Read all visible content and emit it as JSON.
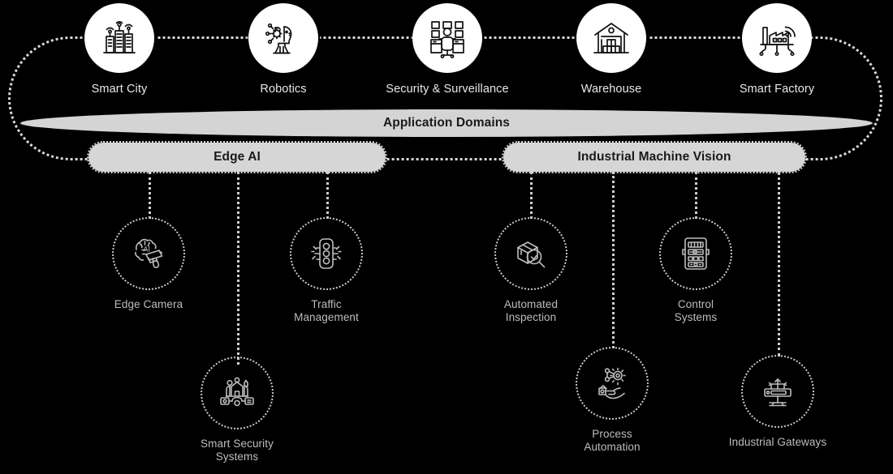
{
  "diagram": {
    "center_bar": {
      "label": "Application Domains"
    },
    "categories": [
      {
        "id": "edge-ai",
        "label": "Edge AI"
      },
      {
        "id": "industrial-machine-vision",
        "label": "Industrial Machine Vision"
      }
    ],
    "domains": [
      {
        "label": "Smart City",
        "icon": "smart-city-icon"
      },
      {
        "label": "Robotics",
        "icon": "robotics-icon"
      },
      {
        "label": "Security & Surveillance",
        "icon": "security-surveillance-icon"
      },
      {
        "label": "Warehouse",
        "icon": "warehouse-icon"
      },
      {
        "label": "Smart Factory",
        "icon": "smart-factory-icon"
      }
    ],
    "edge_ai_nodes": [
      {
        "label_line1": "Edge Camera",
        "label_line2": "",
        "icon": "edge-camera-icon"
      },
      {
        "label_line1": "Smart Security",
        "label_line2": "Systems",
        "icon": "smart-security-systems-icon"
      },
      {
        "label_line1": "Traffic",
        "label_line2": "Management",
        "icon": "traffic-management-icon"
      }
    ],
    "imv_nodes": [
      {
        "label_line1": "Automated",
        "label_line2": "Inspection",
        "icon": "automated-inspection-icon"
      },
      {
        "label_line1": "Process",
        "label_line2": "Automation",
        "icon": "process-automation-icon"
      },
      {
        "label_line1": "Control",
        "label_line2": "Systems",
        "icon": "control-systems-icon"
      },
      {
        "label_line1": "Industrial Gateways",
        "label_line2": "",
        "icon": "industrial-gateways-icon"
      }
    ],
    "colors": {
      "background": "#000000",
      "bar_fill": "#d4d4d4",
      "pill_fill": "#d6d6d6",
      "disc_fill": "#ffffff",
      "line": "#d0d0d0",
      "domain_text": "#e8e8e8",
      "node_text": "#bdbdbd",
      "bar_text": "#1a1a1a"
    }
  }
}
